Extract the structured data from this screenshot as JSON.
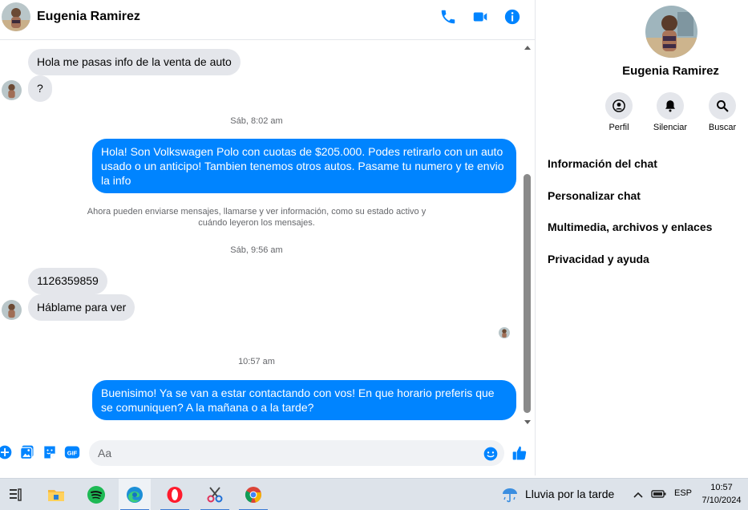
{
  "contact": {
    "name": "Eugenia Ramirez"
  },
  "colors": {
    "accent": "#0084ff",
    "bubble_in": "#e4e6eb",
    "muted": "#65676b"
  },
  "header": {
    "icons": [
      "phone-icon",
      "video-camera-icon",
      "info-icon"
    ]
  },
  "messages": [
    {
      "from": "contact",
      "text": "Hola me pasas info de la venta de auto"
    },
    {
      "from": "contact",
      "text": "?"
    },
    {
      "type": "time",
      "text": "Sáb, 8:02 am"
    },
    {
      "from": "me",
      "text": "Hola! Son Volkswagen Polo con cuotas de $205.000. Podes retirarlo con un auto usado o un anticipo! Tambien tenemos otros autos. Pasame tu numero y te envio la info"
    },
    {
      "type": "system",
      "text": "Ahora pueden enviarse mensajes, llamarse y ver información, como su estado activo y cuándo leyeron los mensajes."
    },
    {
      "type": "time",
      "text": "Sáb, 9:56 am"
    },
    {
      "from": "contact",
      "text": "1126359859"
    },
    {
      "from": "contact",
      "text": "Háblame para ver"
    },
    {
      "type": "time",
      "text": "10:57 am"
    },
    {
      "from": "me",
      "text": "Buenisimo! Ya se van a estar contactando con vos! En que horario preferis que se comuniquen? A la mañana o a la tarde?"
    }
  ],
  "composer": {
    "placeholder": "Aa",
    "icons": [
      "plus-icon",
      "photo-icon",
      "sticker-icon",
      "gif-icon",
      "emoji-icon",
      "thumbs-up-icon"
    ],
    "gif_label": "GIF"
  },
  "info_panel": {
    "name": "Eugenia Ramirez",
    "actions": [
      {
        "label": "Perfil",
        "icon": "profile-icon"
      },
      {
        "label": "Silenciar",
        "icon": "bell-icon"
      },
      {
        "label": "Buscar",
        "icon": "search-icon"
      }
    ],
    "menu": [
      "Información del chat",
      "Personalizar chat",
      "Multimedia, archivos y enlaces",
      "Privacidad y ayuda"
    ]
  },
  "taskbar": {
    "apps": [
      "task-view-icon",
      "file-explorer-icon",
      "spotify-icon",
      "edge-icon",
      "opera-icon",
      "snipping-tool-icon",
      "chrome-icon"
    ],
    "weather": "Lluvia por la tarde",
    "language": "ESP",
    "time": "10:57",
    "date": "7/10/2024"
  }
}
